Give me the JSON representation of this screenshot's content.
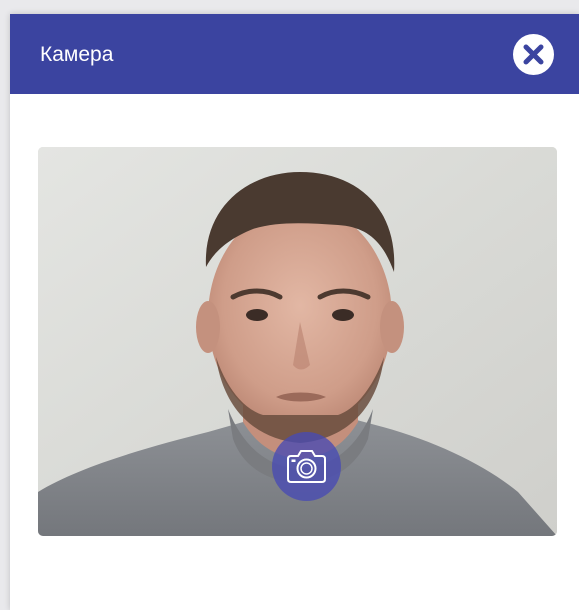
{
  "dialog": {
    "title": "Камера"
  },
  "icons": {
    "close": "close-icon",
    "capture": "camera-icon"
  },
  "colors": {
    "header": "#3b44a0",
    "capture_button": "#484ab4",
    "background": "#ffffff"
  }
}
